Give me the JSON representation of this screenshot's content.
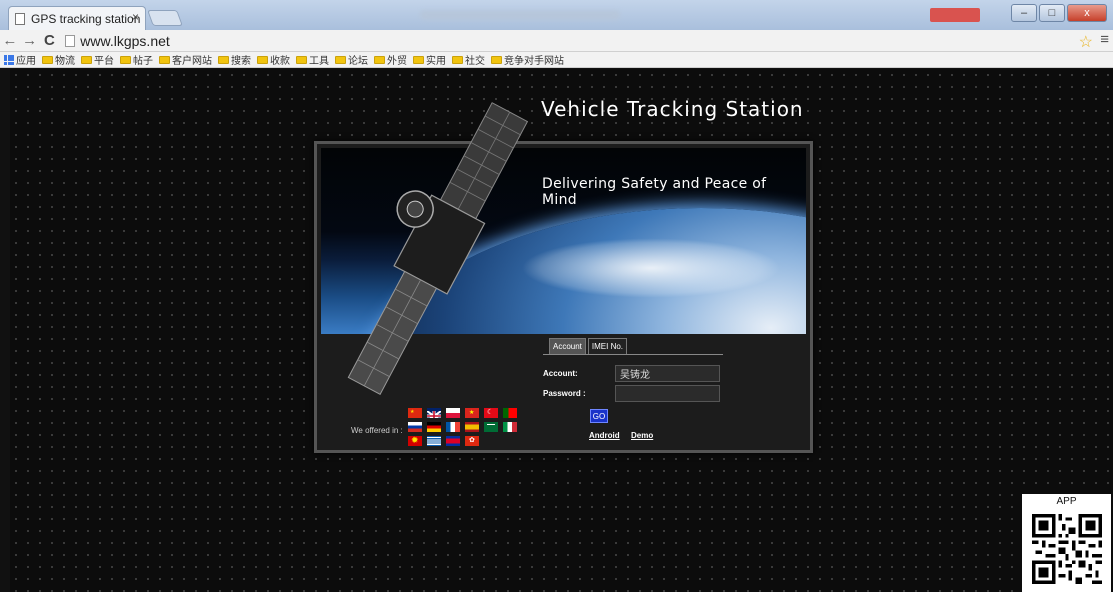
{
  "browser": {
    "tab_title": "GPS tracking station",
    "tab_close": "×",
    "url": "www.lkgps.net",
    "nav": {
      "back": "←",
      "forward": "→",
      "reload": "C"
    },
    "star": "☆",
    "menu": "≡",
    "window_controls": {
      "minimize": "–",
      "maximize": "□",
      "close": "x"
    },
    "bookmarks": [
      "应用",
      "物流",
      "平台",
      "帖子",
      "客户网站",
      "搜索",
      "收款",
      "工具",
      "论坛",
      "外贸",
      "实用",
      "社交",
      "竞争对手网站"
    ]
  },
  "page": {
    "title": "Vehicle Tracking Station",
    "tagline": "Delivering Safety and Peace of Mind",
    "login": {
      "tabs": {
        "account": "Account",
        "imei": "IMEI No."
      },
      "account_label": "Account:",
      "account_value": "吴铸龙",
      "password_label": "Password :",
      "go_label": "GO",
      "android_link": "Android",
      "demo_link": "Demo"
    },
    "offered_in": "We offered in :",
    "qr_label": "APP"
  },
  "colors": {
    "go_button": "#1a33c9",
    "star": "#e8b31d",
    "folder": "#f1c40f"
  }
}
